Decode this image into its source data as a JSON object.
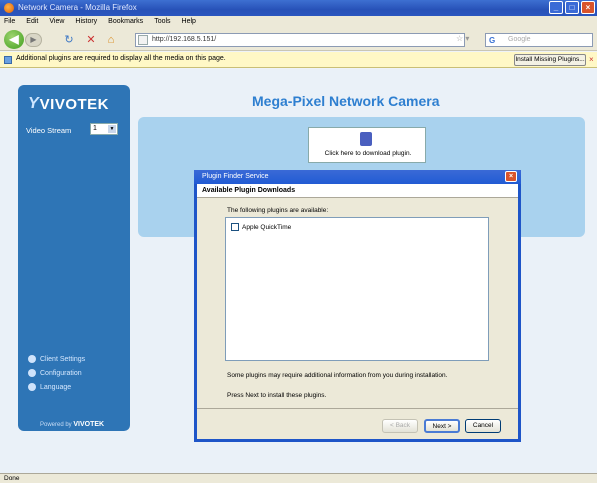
{
  "window": {
    "title": "Network Camera - Mozilla Firefox"
  },
  "menu": [
    "File",
    "Edit",
    "View",
    "History",
    "Bookmarks",
    "Tools",
    "Help"
  ],
  "nav": {
    "url": "http://192.168.5.151/",
    "search_placeholder": "Google"
  },
  "notification": {
    "message": "Additional plugins are required to display all the media on this page.",
    "install_button": "Install Missing Plugins..."
  },
  "sidebar": {
    "logo": "VIVOTEK",
    "video_stream_label": "Video Stream",
    "video_stream_value": "1",
    "links": [
      "Client Settings",
      "Configuration",
      "Language"
    ],
    "powered_by_prefix": "Powered by",
    "powered_by_brand": "VIVOTEK"
  },
  "page": {
    "title": "Mega-Pixel Network Camera",
    "plugin_text": "Click here to download plugin."
  },
  "dialog": {
    "title": "Plugin Finder Service",
    "heading": "Available Plugin Downloads",
    "subtitle": "The following plugins are available:",
    "items": [
      "Apple QuickTime"
    ],
    "note1": "Some plugins may require additional information from you during installation.",
    "note2": "Press Next to install these plugins.",
    "back_button": "< Back",
    "next_button": "Next >",
    "cancel_button": "Cancel"
  },
  "status": {
    "text": "Done"
  }
}
